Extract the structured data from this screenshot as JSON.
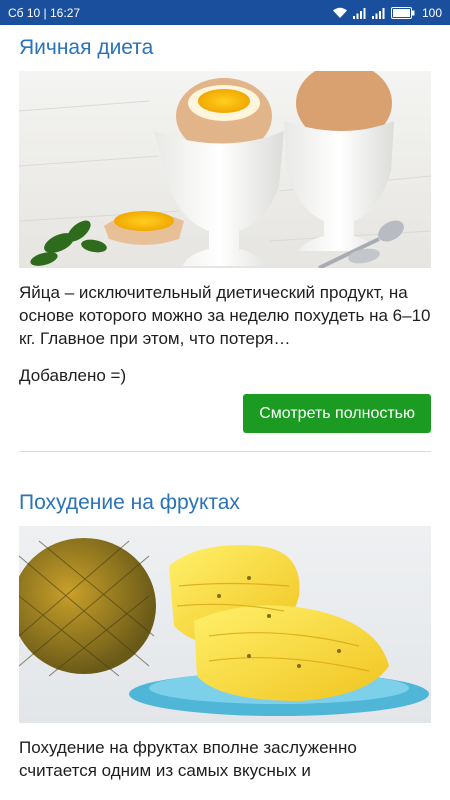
{
  "status_bar": {
    "time": "Сб 10 | 16:27",
    "battery": "100",
    "icons": [
      "wifi-icon",
      "signal-icon",
      "signal-icon",
      "battery-icon"
    ]
  },
  "articles": [
    {
      "title": "Яичная диета",
      "image": "boiled-eggs-in-cups",
      "text": "Яйца – исключительный диетический продукт, на основе которого можно за неделю похудеть на 6–10 кг. Главное при этом, что потеря…",
      "added": "Добавлено =)",
      "button": "Смотреть полностью"
    },
    {
      "title": "Похудение на фруктах",
      "image": "pineapple-slices",
      "text": "Похудение на фруктах вполне заслуженно считается одним из самых вкусных и"
    }
  ],
  "colors": {
    "status_bar": "#1a4f9e",
    "title": "#2a73b8",
    "button": "#1c9b22"
  }
}
